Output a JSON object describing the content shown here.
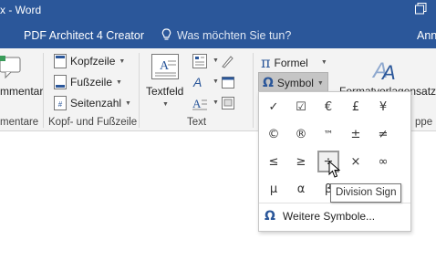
{
  "titlebar": {
    "title": "x - Word",
    "bg": "#2b579a"
  },
  "tabs": {
    "pdf_architect": "PDF Architect 4 Creator",
    "tell_me": "Was möchten Sie tun?",
    "user": "Ann"
  },
  "ribbon": {
    "kommentare": {
      "button": "mmentar",
      "label": "mentare"
    },
    "kopf_fuss": {
      "kopfzeile": "Kopfzeile",
      "fusszeile": "Fußzeile",
      "seitenzahl": "Seitenzahl",
      "label": "Kopf- und Fußzeile"
    },
    "text": {
      "textfeld": "Textfeld",
      "label": "Text"
    },
    "symbole": {
      "formel": "Formel",
      "symbol": "Symbol"
    },
    "formatvorlagen": {
      "button": "Formatvorlagensatz",
      "label": "ppe"
    }
  },
  "symbol_dropdown": {
    "symbols": [
      [
        "✓",
        "☑",
        "€",
        "£",
        "¥"
      ],
      [
        "©",
        "®",
        "™",
        "±",
        "≠"
      ],
      [
        "≤",
        "≥",
        "÷",
        "×",
        "∞"
      ],
      [
        "µ",
        "α",
        "β",
        "",
        ""
      ]
    ],
    "selected": "÷",
    "more_symbols": "Weitere Symbole..."
  },
  "tooltip": "Division Sign",
  "colors": {
    "accent": "#2b579a",
    "ribbon_bg": "#f3f3f3"
  }
}
